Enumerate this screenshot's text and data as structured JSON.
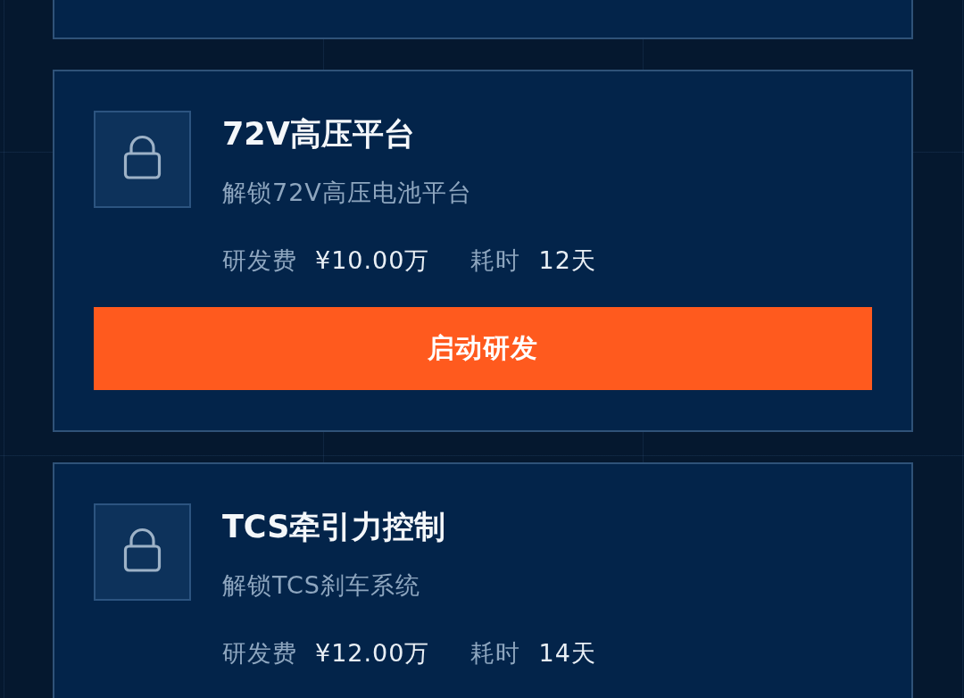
{
  "research_items": [
    {
      "title": "72V高压平台",
      "description": "解锁72V高压电池平台",
      "cost_label": "研发费",
      "cost": "¥10.00万",
      "time_label": "耗时",
      "time": "12天",
      "button": "启动研发"
    },
    {
      "title": "TCS牵引力控制",
      "description": "解锁TCS刹车系统",
      "cost_label": "研发费",
      "cost": "¥12.00万",
      "time_label": "耗时",
      "time": "14天"
    }
  ]
}
